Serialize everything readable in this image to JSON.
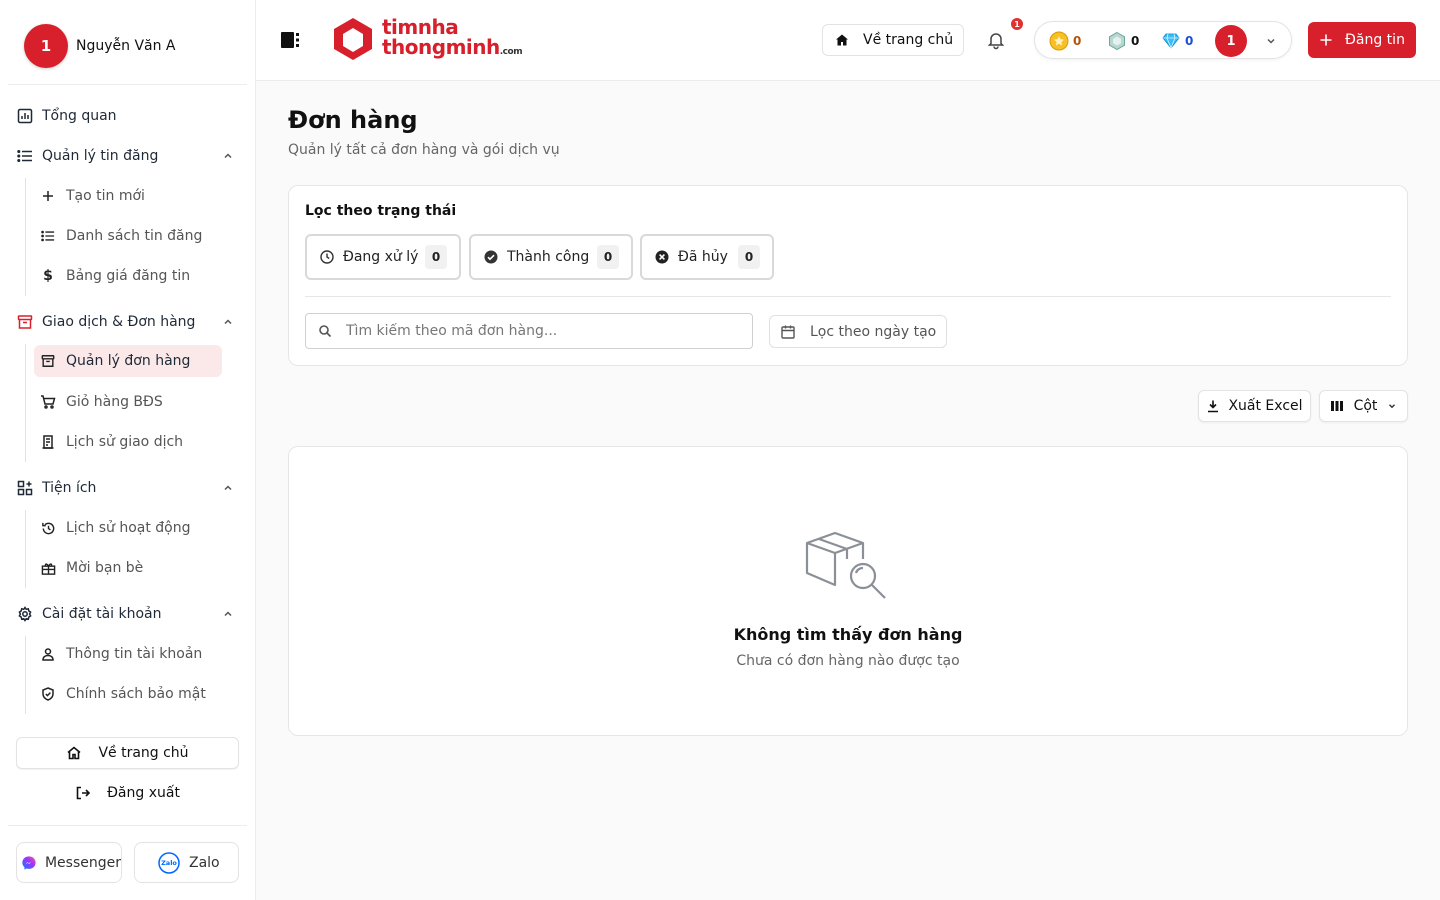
{
  "user": {
    "avatar_initial": "1",
    "name": "Nguyễn Văn A"
  },
  "sidebar": {
    "overview": "Tổng quan",
    "listings": {
      "label": "Quản lý tin đăng",
      "items": [
        "Tạo tin mới",
        "Danh sách tin đăng",
        "Bảng giá đăng tin"
      ]
    },
    "orders": {
      "label": "Giao dịch & Đơn hàng",
      "items": [
        "Quản lý đơn hàng",
        "Giỏ hàng BĐS",
        "Lịch sử giao dịch"
      ]
    },
    "utilities": {
      "label": "Tiện ích",
      "items": [
        "Lịch sử hoạt động",
        "Mời bạn bè"
      ]
    },
    "settings": {
      "label": "Cài đặt tài khoản",
      "items": [
        "Thông tin tài khoản",
        "Chính sách bảo mật"
      ]
    },
    "home_button": "Về trang chủ",
    "logout": "Đăng xuất",
    "messenger": "Messenger",
    "zalo": "Zalo"
  },
  "header": {
    "logo_line1": "timnha",
    "logo_line2": "thongminh",
    "logo_suffix": ".com",
    "home_button": "Về trang chủ",
    "notification_count": "1",
    "wallet": {
      "gold": "0",
      "silver": "0",
      "diamond": "0",
      "avatar_initial": "1"
    },
    "post_button": "Đăng tin"
  },
  "page": {
    "title": "Đơn hàng",
    "subtitle": "Quản lý tất cả đơn hàng và gói dịch vụ",
    "filter_title": "Lọc theo trạng thái",
    "status_filters": [
      {
        "label": "Đang xử lý",
        "count": "0"
      },
      {
        "label": "Thành công",
        "count": "0"
      },
      {
        "label": "Đã hủy",
        "count": "0"
      }
    ],
    "search_placeholder": "Tìm kiếm theo mã đơn hàng...",
    "date_filter": "Lọc theo ngày tạo",
    "export_button": "Xuất Excel",
    "columns_button": "Cột",
    "empty_title": "Không tìm thấy đơn hàng",
    "empty_subtitle": "Chưa có đơn hàng nào được tạo"
  },
  "colors": {
    "brand": "#d7202b",
    "active_bg": "#fbe9ea"
  },
  "icons": [
    "menu-icon",
    "bell-icon",
    "home-icon",
    "plus-icon",
    "chart-icon",
    "list-icon",
    "dollar-icon",
    "box-icon",
    "cart-icon",
    "receipt-icon",
    "grid-icon",
    "history-icon",
    "gift-icon",
    "gear-icon",
    "user-icon",
    "shield-icon",
    "logout-icon",
    "clock-icon",
    "check-circle-icon",
    "x-circle-icon",
    "search-icon",
    "calendar-icon",
    "download-icon",
    "columns-icon",
    "chevron-down-icon",
    "chevron-up-icon",
    "empty-box-search-icon"
  ]
}
